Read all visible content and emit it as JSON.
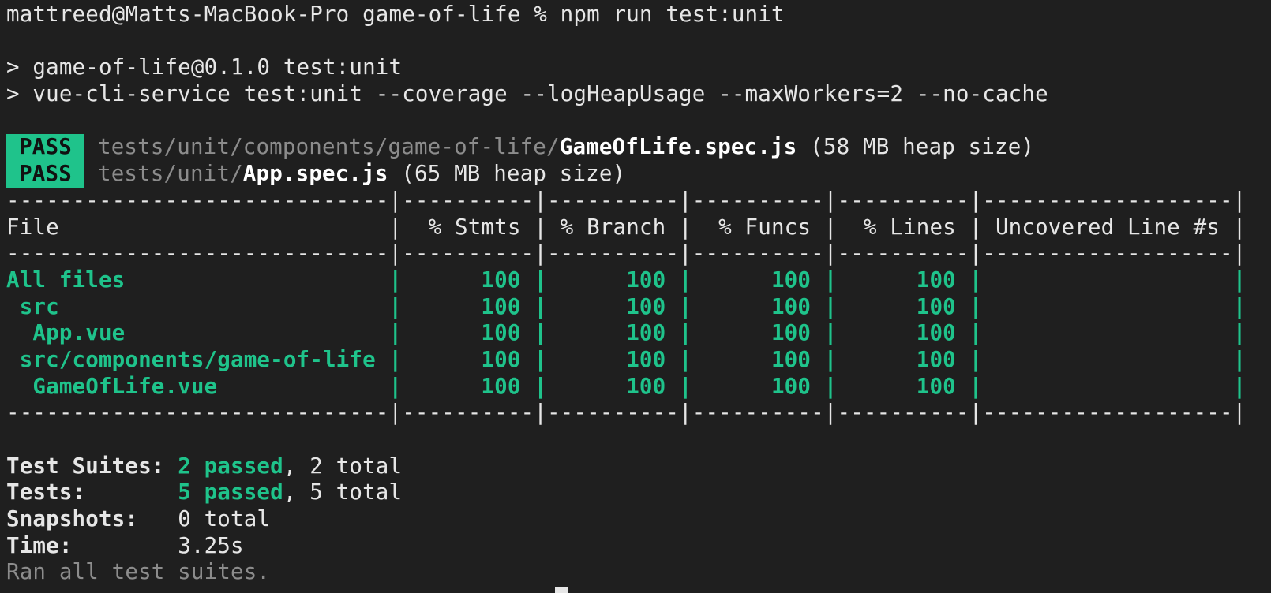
{
  "prompt": {
    "text": "mattreed@Matts-MacBook-Pro game-of-life % npm run test:unit"
  },
  "script_output": [
    "> game-of-life@0.1.0 test:unit",
    "> vue-cli-service test:unit --coverage --logHeapUsage --maxWorkers=2 --no-cache"
  ],
  "results": [
    {
      "status": "PASS",
      "dir": "tests/unit/components/game-of-life/",
      "file": "GameOfLife.spec.js",
      "heap": " (58 MB heap size)"
    },
    {
      "status": "PASS",
      "dir": "tests/unit/",
      "file": "App.spec.js",
      "heap": " (65 MB heap size)"
    }
  ],
  "coverage": {
    "separator": "-----------------------------|----------|----------|----------|----------|-------------------|",
    "header": "File                         |  % Stmts | % Branch |  % Funcs |  % Lines | Uncovered Line #s |",
    "rows": [
      "All files                    |      100 |      100 |      100 |      100 |                   |",
      " src                         |      100 |      100 |      100 |      100 |                   |",
      "  App.vue                    |      100 |      100 |      100 |      100 |                   |",
      " src/components/game-of-life |      100 |      100 |      100 |      100 |                   |",
      "  GameOfLife.vue             |      100 |      100 |      100 |      100 |                   |"
    ]
  },
  "summary": {
    "suites_label": "Test Suites: ",
    "suites_passed": "2 passed",
    "suites_total": ", 2 total",
    "tests_label": "Tests:       ",
    "tests_passed": "5 passed",
    "tests_total": ", 5 total",
    "snapshots_label": "Snapshots:   ",
    "snapshots_value": "0 total",
    "time_label": "Time:        ",
    "time_value": "3.25s",
    "ran_all": "Ran all test suites."
  },
  "colors": {
    "background": "#1f1f1f",
    "text": "#e6e6e6",
    "pass_green": "#1fc38b",
    "dim": "#8c8c8c"
  }
}
